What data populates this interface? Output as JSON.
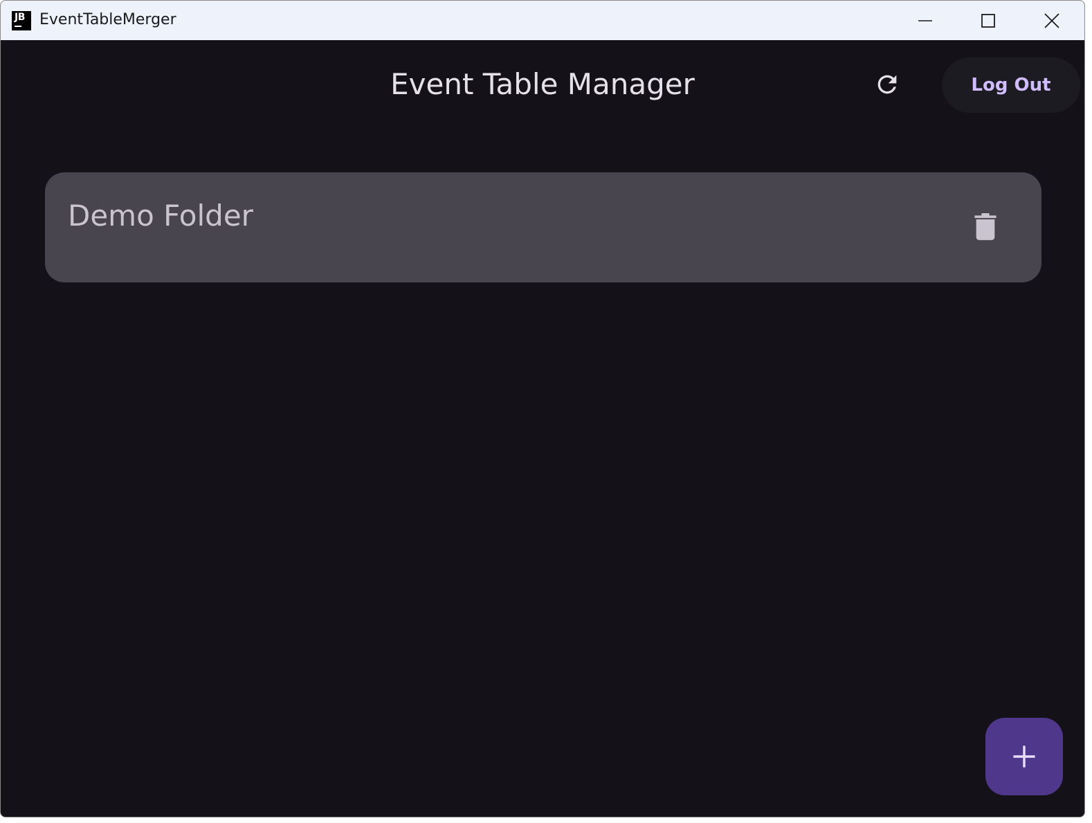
{
  "window": {
    "title": "EventTableMerger",
    "icon_text": "JB"
  },
  "header": {
    "title": "Event Table Manager",
    "refresh_icon": "refresh-icon",
    "logout_label": "Log Out"
  },
  "folders": [
    {
      "name": "Demo Folder",
      "delete_icon": "trash-icon"
    }
  ],
  "fab": {
    "icon": "plus-icon"
  },
  "colors": {
    "background": "#141218",
    "card": "#49454f",
    "accent": "#d0bcff",
    "fab": "#4f378b",
    "titlebar": "#eef2fa"
  }
}
